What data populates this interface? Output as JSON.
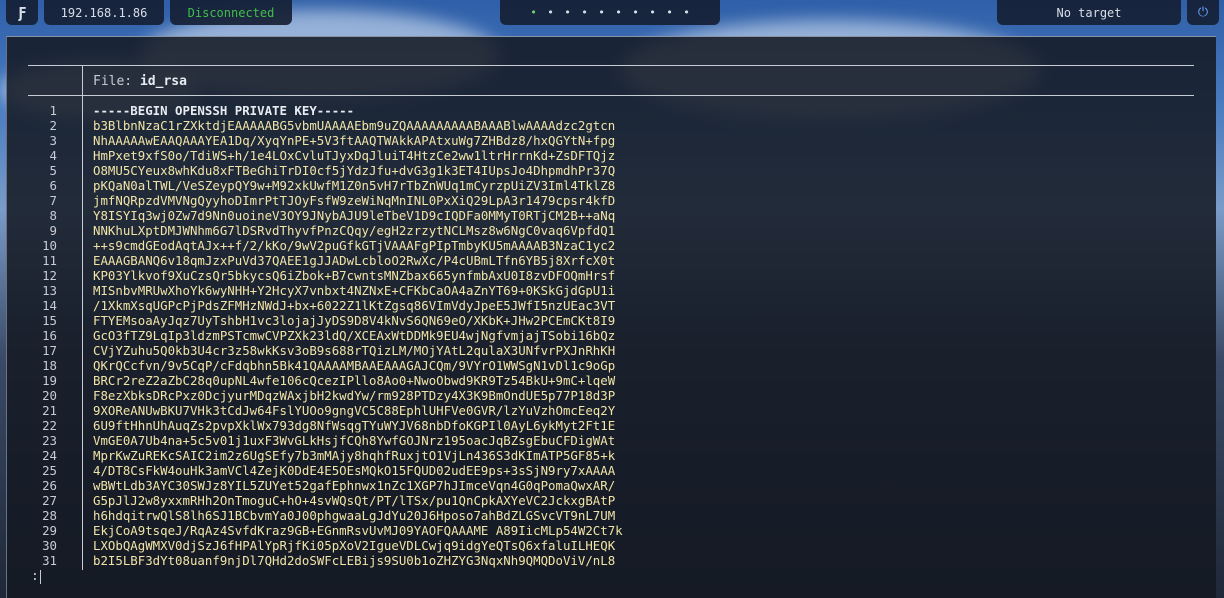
{
  "topbar": {
    "logo_glyph": "Ƒ",
    "ip": "192.168.1.86",
    "connection_status": "Disconnected",
    "workspace_dots": [
      "•",
      "•",
      "•",
      "•",
      "•",
      "•",
      "•",
      "•",
      "•",
      "•"
    ],
    "target": "No target",
    "power_glyph": "⏻"
  },
  "colors": {
    "status_disconnected": "#3fbf4a",
    "key_text": "#f1e4a8",
    "accent_power": "#6aa6ff"
  },
  "file": {
    "label": "File:",
    "name": "id_rsa"
  },
  "lines": [
    {
      "n": "1",
      "text": "-----BEGIN OPENSSH PRIVATE KEY-----"
    },
    {
      "n": "2",
      "text": "b3BlbnNzaC1rZXktdjEAAAAABG5vbmUAAAAEbm9uZQAAAAAAAAABAAABlwAAAAdzc2gtcn"
    },
    {
      "n": "3",
      "text": "NhAAAAAwEAAQAAAYEA1Dq/XyqYnPE+5V3ftAAQTWAkkAPAtxuWg7ZHBdz8/hxQGYtN+fpg"
    },
    {
      "n": "4",
      "text": "HmPxet9xfS0o/TdiWS+h/1e4LOxCvluTJyxDqJluiT4HtzCe2ww1ltrHrrnKd+ZsDFTQjz"
    },
    {
      "n": "5",
      "text": "O8MU5CYeux8whKdu8xFTBeGhiTrDI0cf5jYdzJfu+dvG3g1k3ET4IUpsJo4DhpmdhPr37Q"
    },
    {
      "n": "6",
      "text": "pKQaN0alTWL/VeSZeypQY9w+M92xkUwfM1Z0n5vH7rTbZnWUq1mCyrzpUiZV3Iml4TklZ8"
    },
    {
      "n": "7",
      "text": "jmfNQRpzdVMVNgQyyhoDImrPtTJOyFsfW9zeWiNqMnINL0PxXiQ29LpA3r1479cpsr4kfD"
    },
    {
      "n": "8",
      "text": "Y8ISYIq3wj0Zw7d9Nn0uoineV3OY9JNybAJU9leTbeV1D9cIQDFa0MMyT0RTjCM2B++aNq"
    },
    {
      "n": "9",
      "text": "NNKhuLXptDMJWNhm6G7lDSRvdThyvfPnzCQqy/egH2zrzytNCLMsz8w6NgC0vaq6VpfdQ1"
    },
    {
      "n": "10",
      "text": "++s9cmdGEodAqtAJx++f/2/kKo/9wV2puGfkGTjVAAAFgPIpTmbyKU5mAAAAB3NzaC1yc2"
    },
    {
      "n": "11",
      "text": "EAAAGBANQ6v18qmJzxPuVd37QAEE1gJJADwLcbloO2RwXc/P4cUBmLTfn6YB5j8XrfcX0t"
    },
    {
      "n": "12",
      "text": "KP03Ylkvof9XuCzsQr5bkycsQ6iZbok+B7cwntsMNZbax665ynfmbAxU0I8zvDFOQmHrsf"
    },
    {
      "n": "13",
      "text": "MISnbvMRUwXhoYk6wyNHH+Y2HcyX7vnbxt4NZNxE+CFKbCaOA4aZnYT69+0KSkGjdGpU1i"
    },
    {
      "n": "14",
      "text": "/1XkmXsqUGPcPjPdsZFMHzNWdJ+bx+6022Z1lKtZgsq86VImVdyJpeE5JWfI5nzUEac3VT"
    },
    {
      "n": "15",
      "text": "FTYEMsoaAyJqz7UyTshbH1vc3lojajJyDS9D8V4kNvS6QN69eO/XKbK+JHw2PCEmCKt8I9"
    },
    {
      "n": "16",
      "text": "GcO3fTZ9LqIp3ldzmPSTcmwCVPZXk23ldQ/XCEAxWtDDMk9EU4wjNgfvmjajTSobi16bQz"
    },
    {
      "n": "17",
      "text": "CVjYZuhu5Q0kb3U4cr3z58wkKsv3oB9s688rTQizLM/MOjYAtL2qulaX3UNfvrPXJnRhKH"
    },
    {
      "n": "18",
      "text": "QKrQCcfvn/9v5CqP/cFdqbhn5Bk41QAAAAMBAAEAAAGAJCQm/9VYrO1WWSgN1vDl1c9oGp"
    },
    {
      "n": "19",
      "text": "BRCr2reZ2aZbC28q0upNL4wfe106cQcezIPllo8Ao0+NwoObwd9KR9Tz54BkU+9mC+lqeW"
    },
    {
      "n": "20",
      "text": "F8ezXbksDRcPxz0DcjyurMDqzWAxjbH2kwdYw/rm928PTDzy4X3K9BmOndUE5p77P18d3P"
    },
    {
      "n": "21",
      "text": "9XOReANUwBKU7VHk3tCdJw64FslYUOo9gngVC5C88EphlUHFVe0GVR/lzYuVzhOmcEeq2Y"
    },
    {
      "n": "22",
      "text": "6U9ftHhnUhAuqZs2pvpXklWx793dg8NfWsqgTYuWYJV68nbDfoKGPIl0AyL6ykMyt2Ft1E"
    },
    {
      "n": "23",
      "text": "VmGE0A7Ub4na+5c5v01j1uxF3WvGLkHsjfCQh8YwfGOJNrz195oacJqBZsgEbuCFDigWAt"
    },
    {
      "n": "24",
      "text": "MprKwZuREKcSAIC2im2z6UgSEfy7b3mMAjy8hqhfRuxjtO1VjLn436S3dKImATP5GF85+k"
    },
    {
      "n": "25",
      "text": "4/DT8CsFkW4ouHk3amVCl4ZejK0DdE4E5OEsMQkO15FQUD02udEE9ps+3sSjN9ry7xAAAA"
    },
    {
      "n": "26",
      "text": "wBWtLdb3AYC30SWJz8YIL5ZUYet52gafEphnwx1nZc1XGP7hJImceVqn4G0qPomaQwxAR/"
    },
    {
      "n": "27",
      "text": "G5pJlJ2w8yxxmRHh2OnTmoguC+hO+4svWQsQt/PT/lTSx/pu1QnCpkAXYeVC2JckxgBAtP"
    },
    {
      "n": "28",
      "text": "h6hdqitrwQlS8lh6SJ1BCbvmYa0J00phgwaaLgJdYu20J6Hposo7ahBdZLGSvcVT9nL7UM"
    },
    {
      "n": "29",
      "text": "EkjCoA9tsqeJ/RqAz4SvfdKraz9GB+EGnmRsvUvMJ09YAOFQAAAME A89IicMLp54W2Ct7k"
    },
    {
      "n": "30",
      "text": "LXObQAgWMXV0djSzJ6fHPAlYpRjfKi05pXoV2IgueVDLCwjq9idgYeQTsQ6xfaluILHEQK"
    },
    {
      "n": "31",
      "text": "b2I5LBF3dYt08uanf9njDl7QHd2doSWFcLEBijs9SU0b1oZHZYG3NqxNh9QMQDoViV/nL8"
    }
  ],
  "prompt": ":"
}
